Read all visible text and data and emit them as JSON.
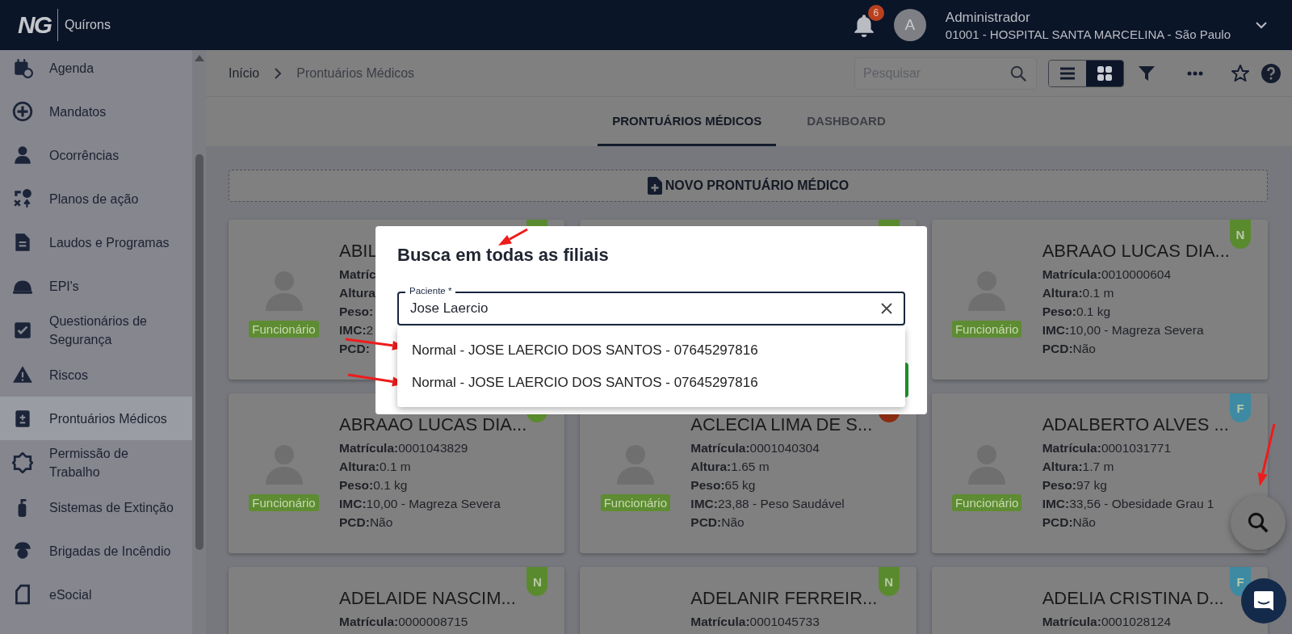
{
  "header": {
    "logo": {
      "mark": "NG",
      "name": "Quírons"
    },
    "notifications": {
      "count": "6"
    },
    "user": {
      "initial": "A",
      "name": "Administrador",
      "organization": "01001 - HOSPITAL SANTA MARCELINA - São Paulo"
    }
  },
  "sidebar": {
    "items": [
      {
        "label": "Agenda",
        "selected": false
      },
      {
        "label": "Mandatos",
        "selected": false
      },
      {
        "label": "Ocorrências",
        "selected": false
      },
      {
        "label": "Planos de ação",
        "selected": false
      },
      {
        "label": "Laudos e Programas",
        "selected": false
      },
      {
        "label": "EPI's",
        "selected": false
      },
      {
        "label": "Questionários de Segurança",
        "selected": false
      },
      {
        "label": "Riscos",
        "selected": false
      },
      {
        "label": "Prontuários Médicos",
        "selected": true
      },
      {
        "label": "Permissão de Trabalho",
        "selected": false
      },
      {
        "label": "Sistemas de Extinção",
        "selected": false
      },
      {
        "label": "Brigadas de Incêndio",
        "selected": false
      },
      {
        "label": "eSocial",
        "selected": false
      }
    ]
  },
  "breadcrumb": [
    "Início",
    "Prontuários Médicos"
  ],
  "toolbar": {
    "search": {
      "placeholder": "Pesquisar"
    },
    "views": [
      {
        "kind": "list",
        "selected": false
      },
      {
        "kind": "grid",
        "selected": true
      }
    ]
  },
  "tabs": [
    {
      "label": "PRONTUÁRIOS MÉDICOS",
      "selected": true
    },
    {
      "label": "DASHBOARD",
      "selected": false
    }
  ],
  "new_button": {
    "label": "NOVO PRONTUÁRIO MÉDICO"
  },
  "cards": [
    {
      "name": "ABIL",
      "role": "Funcionário",
      "badge": {
        "color": "#5a8a2e"
      },
      "fields": [
        {
          "label": "Matríc"
        },
        {
          "label": "Altura"
        },
        {
          "label": "Peso:"
        },
        {
          "label": "IMC:",
          "value": "2"
        },
        {
          "label": "PCD:"
        }
      ]
    },
    {
      "badge": {
        "color": "#5a8a2e"
      }
    },
    {
      "name": "ABRAAO LUCAS DIA...",
      "role": "Funcionário",
      "badge": {
        "letter": "N",
        "color": "#5a8a2e"
      },
      "fields": [
        {
          "label": "Matrícula:",
          "value": "0010000604"
        },
        {
          "label": "Altura:",
          "value": "0.1 m"
        },
        {
          "label": "Peso:",
          "value": "0.1 kg"
        },
        {
          "label": "IMC:",
          "value": "10,00 - Magreza Severa"
        },
        {
          "label": "PCD:",
          "value": "Não"
        }
      ]
    },
    {
      "name": "ABRAAO LUCAS DIA...",
      "role": "Funcionário",
      "badge": {
        "color": "#5a8a2e"
      },
      "fields": [
        {
          "label": "Matrícula:",
          "value": "0001043829"
        },
        {
          "label": "Altura:",
          "value": "0.1 m"
        },
        {
          "label": "Peso:",
          "value": "0.1 kg"
        },
        {
          "label": "IMC:",
          "value": "10,00 - Magreza Severa"
        },
        {
          "label": "PCD:",
          "value": "Não"
        }
      ]
    },
    {
      "name": "ACLECIA LIMA DE S...",
      "role": "Funcionário",
      "badge": {
        "color": "#8a2c12"
      },
      "fields": [
        {
          "label": "Matrícula:",
          "value": "0001040304"
        },
        {
          "label": "Altura:",
          "value": "1.65 m"
        },
        {
          "label": "Peso:",
          "value": "65 kg"
        },
        {
          "label": "IMC:",
          "value": "23,88 - Peso Saudável"
        },
        {
          "label": "PCD:",
          "value": "Não"
        }
      ]
    },
    {
      "name": "ADALBERTO ALVES ...",
      "role": "Funcionário",
      "badge": {
        "letter": "F",
        "color": "#3e8aa2"
      },
      "fields": [
        {
          "label": "Matrícula:",
          "value": "0001031771"
        },
        {
          "label": "Altura:",
          "value": "1.7 m"
        },
        {
          "label": "Peso:",
          "value": "97 kg"
        },
        {
          "label": "IMC:",
          "value": "33,56 - Obesidade Grau 1"
        },
        {
          "label": "PCD:",
          "value": "Não"
        }
      ]
    },
    {
      "name": "ADELAIDE NASCIM...",
      "badge": {
        "letter": "N",
        "color": "#5a8a2e"
      },
      "fields": [
        {
          "label": "Matrícula:",
          "value": "0000008715"
        }
      ]
    },
    {
      "name": "ADELANIR FERREIR...",
      "badge": {
        "letter": "N",
        "color": "#5a8a2e"
      },
      "fields": [
        {
          "label": "Matrícula:",
          "value": "0001045733"
        }
      ]
    },
    {
      "name": "ADELIA CRISTINA D...",
      "badge": {
        "letter": "F",
        "color": "#3e8aa2"
      },
      "fields": [
        {
          "label": "Matrícula:",
          "value": "0001028124"
        }
      ]
    }
  ],
  "dialog": {
    "title": "Busca em todas as filiais",
    "field": {
      "label": "Paciente *",
      "value": "Jose Laercio"
    },
    "results": [
      "Normal - JOSE LAERCIO DOS SANTOS - 07645297816",
      "Normal - JOSE LAERCIO DOS SANTOS - 07645297816"
    ]
  },
  "annotation_arrows": [
    {
      "kind": "arrow"
    },
    {
      "kind": "arrow"
    },
    {
      "kind": "arrow"
    },
    {
      "kind": "arrow"
    }
  ]
}
